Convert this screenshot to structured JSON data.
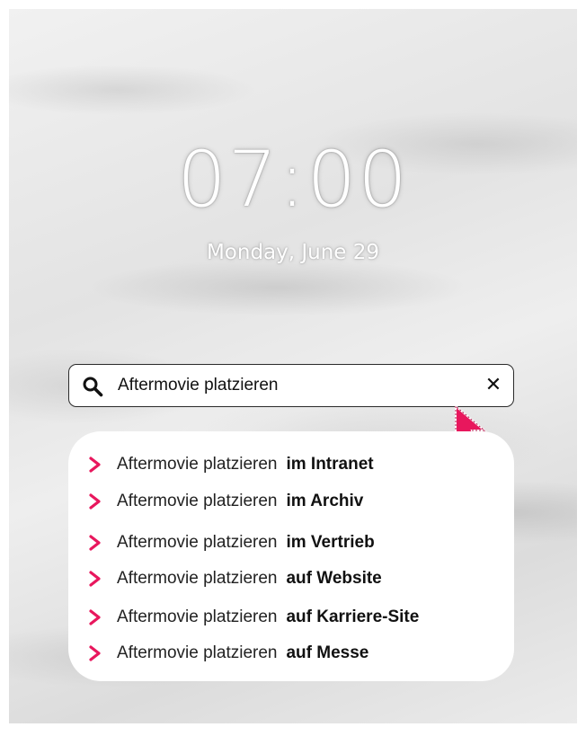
{
  "lockscreen": {
    "time": "07:00",
    "date": "Monday, June 29"
  },
  "search": {
    "query": "Aftermovie platzieren",
    "icon": "search-icon",
    "clear_icon": "close-icon",
    "clear_label": "✕"
  },
  "suggestions": [
    {
      "base": "Aftermovie platzieren",
      "suffix": "im Intranet"
    },
    {
      "base": "Aftermovie platzieren",
      "suffix": "im Archiv"
    },
    {
      "base": "Aftermovie platzieren",
      "suffix": "im Vertrieb"
    },
    {
      "base": "Aftermovie platzieren",
      "suffix": "auf Website"
    },
    {
      "base": "Aftermovie platzieren",
      "suffix": "auf Karriere-Site"
    },
    {
      "base": "Aftermovie platzieren",
      "suffix": "auf Messe"
    }
  ],
  "colors": {
    "accent": "#e8175d",
    "text": "#222222",
    "background": "#e6e6e6"
  }
}
